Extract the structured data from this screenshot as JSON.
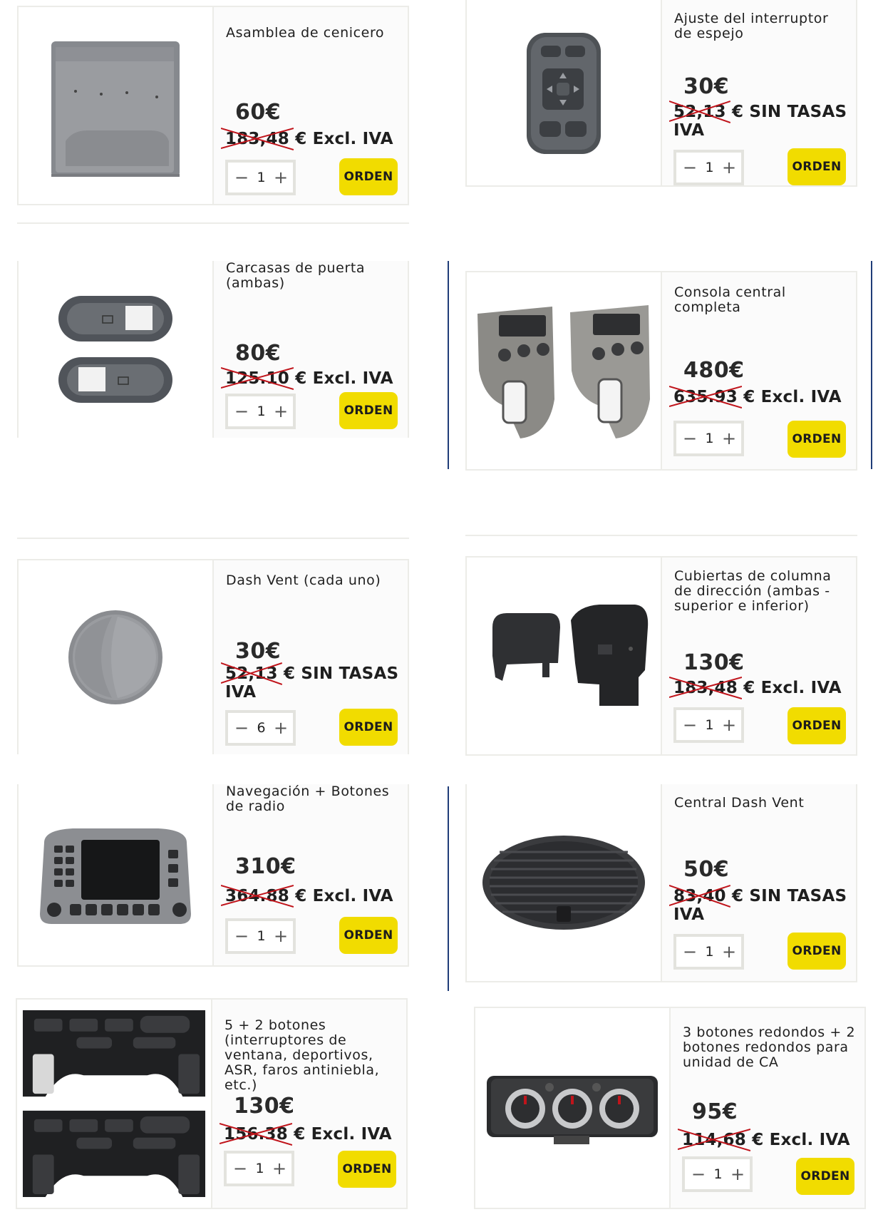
{
  "currency_symbol": "€",
  "products": [
    {
      "title": "Asamblea de cenicero",
      "price": "60€",
      "old_price": "183,48",
      "old_suffix": "€ Excl. IVA",
      "qty": "1",
      "order_label": "ORDEN",
      "image_icon": "ashtray-assembly-image"
    },
    {
      "title": "Ajuste del interruptor de espejo",
      "price": "30€",
      "old_price": "52,13",
      "old_suffix": "€ SIN TASAS IVA",
      "qty": "1",
      "order_label": "ORDEN",
      "image_icon": "mirror-switch-image"
    },
    {
      "title": "Carcasas de puerta (ambas)",
      "price": "80€",
      "old_price": "125.10",
      "old_suffix": "€ Excl. IVA",
      "qty": "1",
      "order_label": "ORDEN",
      "image_icon": "door-housings-image"
    },
    {
      "title": "Consola central completa",
      "price": "480€",
      "old_price": "635.93",
      "old_suffix": "€ Excl. IVA",
      "qty": "1",
      "order_label": "ORDEN",
      "image_icon": "center-console-image"
    },
    {
      "title": "Dash Vent (cada uno)",
      "price": "30€",
      "old_price": "52,13",
      "old_suffix": "€ SIN TASAS IVA",
      "qty": "6",
      "order_label": "ORDEN",
      "image_icon": "dash-vent-image"
    },
    {
      "title": "Cubiertas de columna de dirección (ambas - superior e inferior)",
      "price": "130€",
      "old_price": "183,48",
      "old_suffix": "€ Excl. IVA",
      "qty": "1",
      "order_label": "ORDEN",
      "image_icon": "steering-column-covers-image"
    },
    {
      "title": "Navegación + Botones de radio",
      "price": "310€",
      "old_price": "364.88",
      "old_suffix": "€ Excl. IVA",
      "qty": "1",
      "order_label": "ORDEN",
      "image_icon": "navigation-radio-image"
    },
    {
      "title": "Central Dash Vent",
      "price": "50€",
      "old_price": "83,40",
      "old_suffix": "€ SIN TASAS IVA",
      "qty": "1",
      "order_label": "ORDEN",
      "image_icon": "central-dash-vent-image"
    },
    {
      "title": "5 + 2 botones (interruptores de ventana, deportivos, ASR, faros antiniebla, etc.)",
      "price": "130€",
      "old_price": "156.38",
      "old_suffix": "€ Excl. IVA",
      "qty": "1",
      "order_label": "ORDEN",
      "image_icon": "switch-panels-image"
    },
    {
      "title": "3 botones redondos + 2 botones redondos para unidad de CA",
      "price": "95€",
      "old_price": "114,68",
      "old_suffix": "€ Excl. IVA",
      "qty": "1",
      "order_label": "ORDEN",
      "image_icon": "ac-unit-image"
    }
  ],
  "colors": {
    "order_button": "#f1dc00",
    "strike": "#c0141b",
    "border": "#ecece8"
  }
}
